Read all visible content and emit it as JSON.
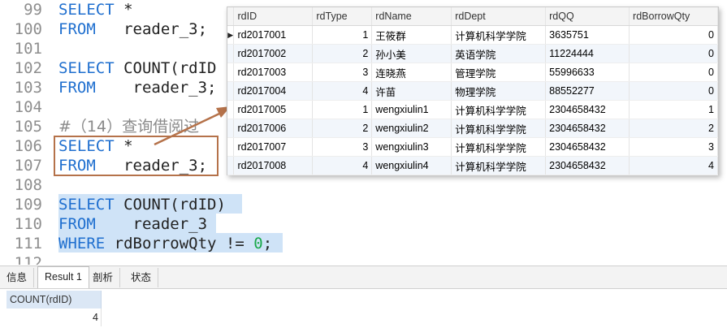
{
  "editor": {
    "lines": [
      {
        "num": "99"
      },
      {
        "num": "100"
      },
      {
        "num": "101"
      },
      {
        "num": "102"
      },
      {
        "num": "103"
      },
      {
        "num": "104"
      },
      {
        "num": "105"
      },
      {
        "num": "106"
      },
      {
        "num": "107"
      },
      {
        "num": "108"
      },
      {
        "num": "109"
      },
      {
        "num": "110"
      },
      {
        "num": "111"
      },
      {
        "num": "112"
      }
    ],
    "kw_select": "SELECT",
    "kw_from": "FROM",
    "kw_where": "WHERE",
    "star": " *",
    "table": "reader_3;",
    "table_nosemi": "reader_3",
    "count_partial": " COUNT(rdID",
    "count_full": " COUNT(rdID)",
    "comment": "#（14）查询借阅过",
    "where_cond": " rdBorrowQty != ",
    "zero": "0",
    "semi": ";"
  },
  "popup": {
    "columns": [
      "rdID",
      "rdType",
      "rdName",
      "rdDept",
      "rdQQ",
      "rdBorrowQty"
    ],
    "current_indicator": "▶",
    "rows": [
      [
        "rd2017001",
        "1",
        "王筱群",
        "计算机科学学院",
        "3635751",
        "0"
      ],
      [
        "rd2017002",
        "2",
        "孙小美",
        "英语学院",
        "11224444",
        "0"
      ],
      [
        "rd2017003",
        "3",
        "连晓燕",
        "管理学院",
        "55996633",
        "0"
      ],
      [
        "rd2017004",
        "4",
        "许苗",
        "物理学院",
        "88552277",
        "0"
      ],
      [
        "rd2017005",
        "1",
        "wengxiulin1",
        "计算机科学学院",
        "2304658432",
        "1"
      ],
      [
        "rd2017006",
        "2",
        "wengxiulin2",
        "计算机科学学院",
        "2304658432",
        "2"
      ],
      [
        "rd2017007",
        "3",
        "wengxiulin3",
        "计算机科学学院",
        "2304658432",
        "3"
      ],
      [
        "rd2017008",
        "4",
        "wengxiulin4",
        "计算机科学学院",
        "2304658432",
        "4"
      ]
    ]
  },
  "tabs": [
    "信息",
    "Result 1",
    "剖析",
    "状态"
  ],
  "active_tab": "Result 1",
  "result": {
    "column": "COUNT(rdID)",
    "value": "4"
  },
  "colors": {
    "keyword": "#1f6fcf",
    "number": "#19a84a",
    "selection": "#cfe3f7",
    "highlight_box": "#b5724a",
    "arrow": "#b5724a"
  }
}
